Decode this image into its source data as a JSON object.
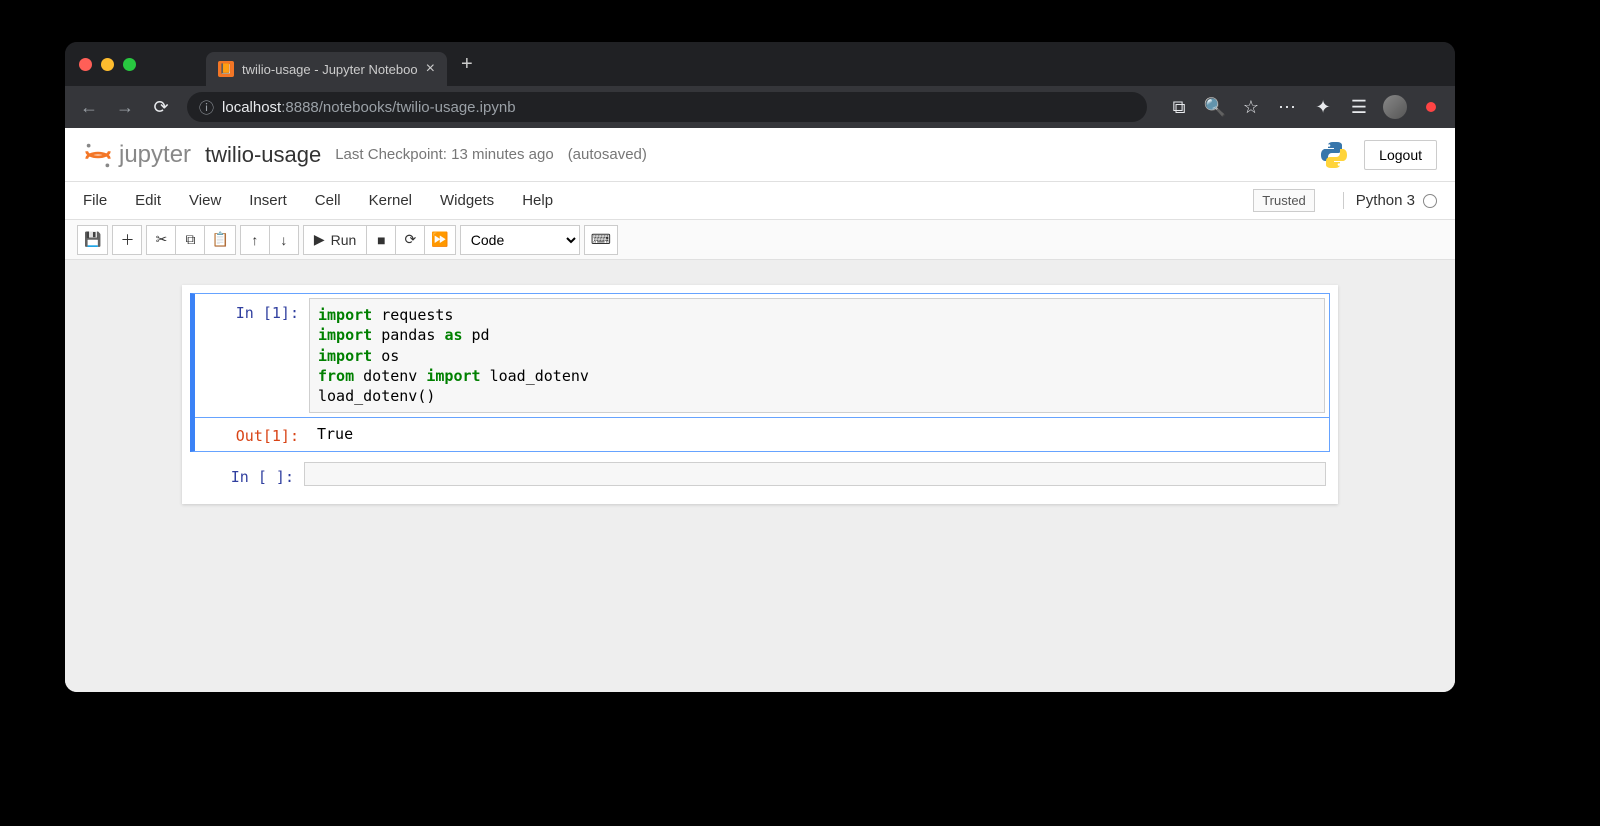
{
  "browser": {
    "tab_title": "twilio-usage - Jupyter Noteboo",
    "url_host": "localhost",
    "url_port_path": ":8888/notebooks/twilio-usage.ipynb"
  },
  "header": {
    "logo_text": "jupyter",
    "notebook_title": "twilio-usage",
    "checkpoint": "Last Checkpoint: 13 minutes ago",
    "autosave": "(autosaved)",
    "logout": "Logout"
  },
  "menu": {
    "items": [
      "File",
      "Edit",
      "View",
      "Insert",
      "Cell",
      "Kernel",
      "Widgets",
      "Help"
    ],
    "trusted": "Trusted",
    "kernel": "Python 3"
  },
  "toolbar": {
    "run_label": "Run",
    "cell_type": "Code"
  },
  "cells": [
    {
      "in_prompt": "In [1]:",
      "code_tokens": [
        [
          "kw",
          "import"
        ],
        [
          "t",
          " requests\n"
        ],
        [
          "kw",
          "import"
        ],
        [
          "t",
          " pandas "
        ],
        [
          "kw",
          "as"
        ],
        [
          "t",
          " pd\n"
        ],
        [
          "kw",
          "import"
        ],
        [
          "t",
          " os\n"
        ],
        [
          "kw",
          "from"
        ],
        [
          "t",
          " dotenv "
        ],
        [
          "kw",
          "import"
        ],
        [
          "t",
          " load_dotenv\n"
        ],
        [
          "t",
          "load_dotenv()"
        ]
      ],
      "out_prompt": "Out[1]:",
      "output": "True"
    },
    {
      "in_prompt": "In [ ]:",
      "code_tokens": [],
      "out_prompt": null,
      "output": null
    }
  ]
}
